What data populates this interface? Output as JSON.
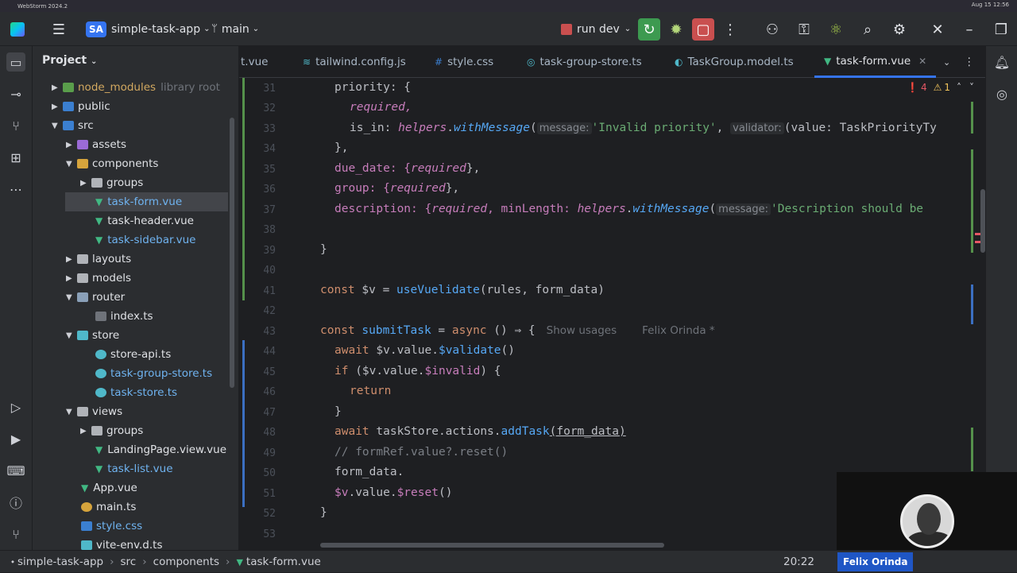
{
  "system": {
    "app": "WebStorm 2024.2",
    "datetime": "Aug 15  12:56"
  },
  "toolbar": {
    "project_badge": "SA",
    "project_name": "simple-task-app",
    "branch": "main",
    "run_config": "run dev"
  },
  "project_panel": {
    "title": "Project",
    "items": [
      {
        "label": "node_modules",
        "extra": "library root"
      },
      {
        "label": "public"
      },
      {
        "label": "src"
      },
      {
        "label": "assets"
      },
      {
        "label": "components"
      },
      {
        "label": "groups"
      },
      {
        "label": "task-form.vue"
      },
      {
        "label": "task-header.vue"
      },
      {
        "label": "task-sidebar.vue"
      },
      {
        "label": "layouts"
      },
      {
        "label": "models"
      },
      {
        "label": "router"
      },
      {
        "label": "index.ts"
      },
      {
        "label": "store"
      },
      {
        "label": "store-api.ts"
      },
      {
        "label": "task-group-store.ts"
      },
      {
        "label": "task-store.ts"
      },
      {
        "label": "views"
      },
      {
        "label": "groups"
      },
      {
        "label": "LandingPage.view.vue"
      },
      {
        "label": "task-list.vue"
      },
      {
        "label": "App.vue"
      },
      {
        "label": "main.ts"
      },
      {
        "label": "style.css"
      },
      {
        "label": "vite-env.d.ts"
      }
    ]
  },
  "tabs": [
    {
      "label": "t.vue"
    },
    {
      "label": "tailwind.config.js"
    },
    {
      "label": "style.css"
    },
    {
      "label": "task-group-store.ts"
    },
    {
      "label": "TaskGroup.model.ts"
    },
    {
      "label": "task-form.vue"
    }
  ],
  "inspections": {
    "errors": "4",
    "warnings": "1"
  },
  "line_numbers": [
    "31",
    "32",
    "33",
    "34",
    "35",
    "36",
    "37",
    "38",
    "39",
    "40",
    "41",
    "42",
    "43",
    "44",
    "45",
    "46",
    "47",
    "48",
    "49",
    "50",
    "51",
    "52",
    "53"
  ],
  "code": {
    "l31": "priority: {",
    "l32": "required,",
    "l33a": "is_in: ",
    "l33b": "helpers",
    "l33c": ".",
    "l33d": "withMessage",
    "l33e": "(",
    "l33hint1": "message:",
    "l33f": "'Invalid priority'",
    "l33g": ", ",
    "l33hint2": "validator:",
    "l33h": "(value: TaskPriorityTy",
    "l34": "},",
    "l35a": "due_date: {",
    "l35b": "required",
    "l35c": "},",
    "l36a": "group: {",
    "l36b": "required",
    "l36c": "},",
    "l37a": "description: {",
    "l37b": "required",
    "l37c": ", minLength: ",
    "l37d": "helpers",
    "l37e": ".",
    "l37f": "withMessage",
    "l37g": "(",
    "l37hint": "message:",
    "l37h": "'Description should be",
    "l39": "}",
    "l41a": "const",
    "l41b": " $v = ",
    "l41c": "useVuelidate",
    "l41d": "(rules, form_data)",
    "l43a": "const",
    "l43b": " submitTask",
    "l43c": " = ",
    "l43d": "async",
    "l43e": " () ⇒ {",
    "l43usage": "Show usages",
    "l43author": "Felix Orinda *",
    "l44a": "await",
    "l44b": " $v.value.",
    "l44c": "$validate",
    "l44d": "()",
    "l45a": "if",
    "l45b": " ($v.value.",
    "l45c": "$invalid",
    "l45d": ") {",
    "l46": "return",
    "l47": "}",
    "l48a": "await",
    "l48b": " taskStore.actions.",
    "l48c": "addTask",
    "l48d": "(form_data)",
    "l49": "// formRef.value?.reset()",
    "l50": "form_data.",
    "l51a": "$v",
    "l51b": ".value.",
    "l51c": "$reset",
    "l51d": "()",
    "l52": "}"
  },
  "statusbar": {
    "breadcrumb": [
      "simple-task-app",
      "src",
      "components",
      "task-form.vue"
    ],
    "position": "20:22",
    "user": "Felix Orinda"
  },
  "colors": {
    "accent": "#3574f0",
    "vue_green": "#41b883"
  }
}
